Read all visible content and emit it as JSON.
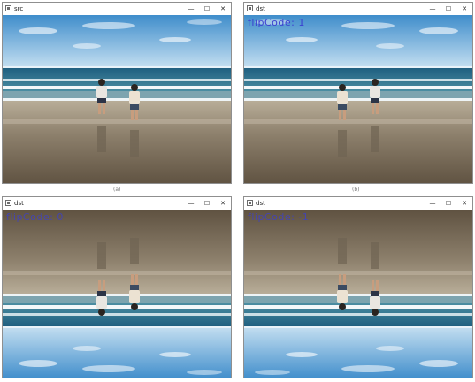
{
  "windows": [
    {
      "title": "src",
      "flip_label": "",
      "min": "—",
      "max": "☐",
      "close": "✕"
    },
    {
      "title": "dst",
      "flip_label": "flipCode: 1",
      "min": "—",
      "max": "☐",
      "close": "✕"
    },
    {
      "title": "dst",
      "flip_label": "flipCode: 0",
      "min": "—",
      "max": "☐",
      "close": "✕"
    },
    {
      "title": "dst",
      "flip_label": "flipCode: -1",
      "min": "—",
      "max": "☐",
      "close": "✕"
    }
  ],
  "captions": [
    "(a)",
    "(b)"
  ],
  "colors": {
    "sky_top": "#4a95cf",
    "sky_bottom": "#cfe6f6",
    "sea": "#2e6f8e",
    "foam": "#f2f6f8",
    "sand_wet": "#9c8f7a",
    "sand_dark": "#6b5d49",
    "label": "#3b3fd0"
  }
}
